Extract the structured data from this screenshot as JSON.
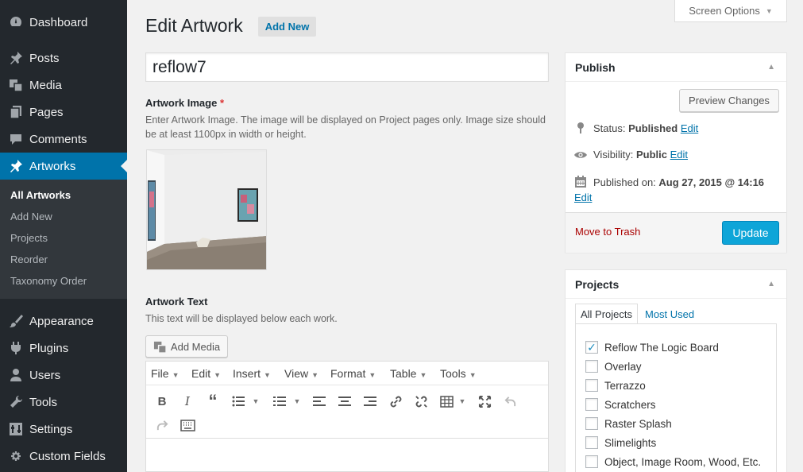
{
  "sidebar": {
    "items": [
      {
        "label": "Dashboard",
        "icon": "dashboard-icon"
      },
      {
        "label": "Posts",
        "icon": "pin-icon"
      },
      {
        "label": "Media",
        "icon": "media-icon"
      },
      {
        "label": "Pages",
        "icon": "pages-icon"
      },
      {
        "label": "Comments",
        "icon": "comment-icon"
      },
      {
        "label": "Artworks",
        "icon": "pin-icon"
      },
      {
        "label": "Appearance",
        "icon": "brush-icon"
      },
      {
        "label": "Plugins",
        "icon": "plug-icon"
      },
      {
        "label": "Users",
        "icon": "user-icon"
      },
      {
        "label": "Tools",
        "icon": "wrench-icon"
      },
      {
        "label": "Settings",
        "icon": "settings-icon"
      },
      {
        "label": "Custom Fields",
        "icon": "gear-icon"
      }
    ],
    "submenu": [
      "All Artworks",
      "Add New",
      "Projects",
      "Reorder",
      "Taxonomy Order"
    ]
  },
  "header": {
    "title": "Edit Artwork",
    "add_new": "Add New",
    "screen_options": "Screen Options"
  },
  "post": {
    "title_value": "reflow7",
    "image_label": "Artwork Image",
    "required_mark": "*",
    "image_desc": "Enter Artwork Image. The image will be displayed on Project pages only. Image size should be at least 1100px in width or height.",
    "text_label": "Artwork Text",
    "text_desc": "This text will be displayed below each work.",
    "add_media": "Add Media"
  },
  "editor": {
    "menus": [
      "File",
      "Edit",
      "Insert",
      "View",
      "Format",
      "Table",
      "Tools"
    ]
  },
  "publish": {
    "title": "Publish",
    "preview": "Preview Changes",
    "status_label": "Status:",
    "status_value": "Published",
    "visibility_label": "Visibility:",
    "visibility_value": "Public",
    "published_label": "Published on:",
    "published_value": "Aug 27, 2015 @ 14:16",
    "edit": "Edit",
    "trash": "Move to Trash",
    "update": "Update"
  },
  "projects": {
    "title": "Projects",
    "tab_all": "All Projects",
    "tab_used": "Most Used",
    "items": [
      {
        "label": "Reflow The Logic Board",
        "checked": true
      },
      {
        "label": "Overlay",
        "checked": false
      },
      {
        "label": "Terrazzo",
        "checked": false
      },
      {
        "label": "Scratchers",
        "checked": false
      },
      {
        "label": "Raster Splash",
        "checked": false
      },
      {
        "label": "Slimelights",
        "checked": false
      },
      {
        "label": "Object, Image Room, Wood, Etc.",
        "checked": false
      }
    ]
  },
  "colors": {
    "accent": "#0073aa",
    "sidebar": "#23282d",
    "update": "#0ea5d8"
  }
}
